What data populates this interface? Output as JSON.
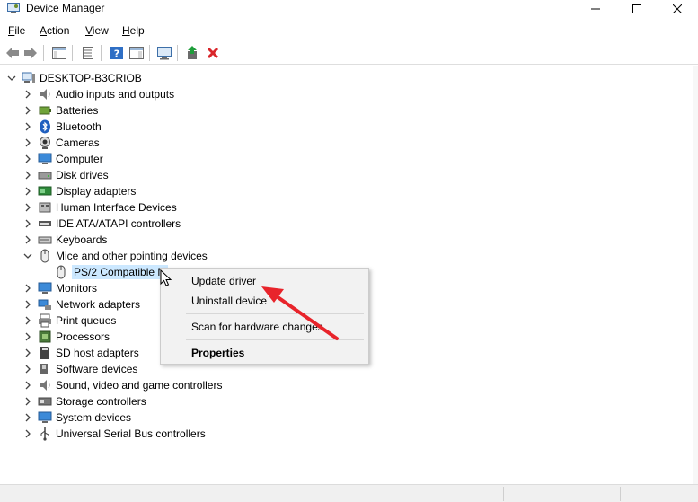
{
  "window": {
    "title": "Device Manager"
  },
  "menu": [
    {
      "key": "F",
      "rest": "ile"
    },
    {
      "key": "A",
      "rest": "ction"
    },
    {
      "key": "V",
      "rest": "iew"
    },
    {
      "key": "H",
      "rest": "elp"
    }
  ],
  "tree": {
    "root": "DESKTOP-B3CRIOB",
    "categories": [
      {
        "label": "Audio inputs and outputs",
        "icon": "speaker-icon"
      },
      {
        "label": "Batteries",
        "icon": "battery-icon"
      },
      {
        "label": "Bluetooth",
        "icon": "bluetooth-icon"
      },
      {
        "label": "Cameras",
        "icon": "camera-icon"
      },
      {
        "label": "Computer",
        "icon": "computer-icon"
      },
      {
        "label": "Disk drives",
        "icon": "disk-drive-icon"
      },
      {
        "label": "Display adapters",
        "icon": "display-adapter-icon"
      },
      {
        "label": "Human Interface Devices",
        "icon": "hid-icon"
      },
      {
        "label": "IDE ATA/ATAPI controllers",
        "icon": "ide-controller-icon"
      },
      {
        "label": "Keyboards",
        "icon": "keyboard-icon"
      },
      {
        "label": "Mice and other pointing devices",
        "icon": "mouse-icon",
        "expanded": true
      },
      {
        "label": "Monitors",
        "icon": "monitor-icon"
      },
      {
        "label": "Network adapters",
        "icon": "network-adapter-icon"
      },
      {
        "label": "Print queues",
        "icon": "printer-icon"
      },
      {
        "label": "Processors",
        "icon": "processor-icon"
      },
      {
        "label": "SD host adapters",
        "icon": "sd-card-icon"
      },
      {
        "label": "Software devices",
        "icon": "software-device-icon"
      },
      {
        "label": "Sound, video and game controllers",
        "icon": "sound-icon"
      },
      {
        "label": "Storage controllers",
        "icon": "storage-controller-icon"
      },
      {
        "label": "System devices",
        "icon": "system-device-icon"
      },
      {
        "label": "Universal Serial Bus controllers",
        "icon": "usb-icon"
      }
    ],
    "selected_child": "PS/2 Compatible M"
  },
  "context_menu": {
    "update_driver": "Update driver",
    "uninstall_device": "Uninstall device",
    "scan_hardware": "Scan for hardware changes",
    "properties": "Properties"
  },
  "colors": {
    "selection": "#cce8ff",
    "annotation_arrow": "#e8242b",
    "delete_icon": "#d9262b"
  }
}
